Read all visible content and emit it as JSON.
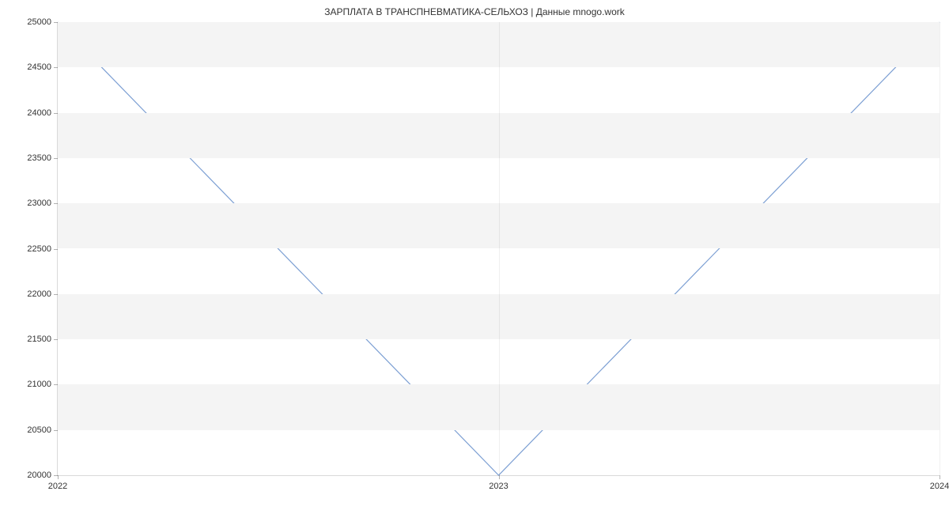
{
  "chart_data": {
    "type": "line",
    "title": "ЗАРПЛАТА В   ТРАНСПНЕВМАТИКА-СЕЛЬХОЗ | Данные mnogo.work",
    "x": [
      2022,
      2023,
      2024
    ],
    "values": [
      25000,
      20000,
      25000
    ],
    "x_ticks": [
      2022,
      2023,
      2024
    ],
    "y_ticks": [
      20000,
      20500,
      21000,
      21500,
      22000,
      22500,
      23000,
      23500,
      24000,
      24500,
      25000
    ],
    "xlim": [
      2022,
      2024
    ],
    "ylim": [
      20000,
      25000
    ],
    "xlabel": "",
    "ylabel": "",
    "line_color": "#7c9fd3",
    "band_color": "#f4f4f4"
  }
}
